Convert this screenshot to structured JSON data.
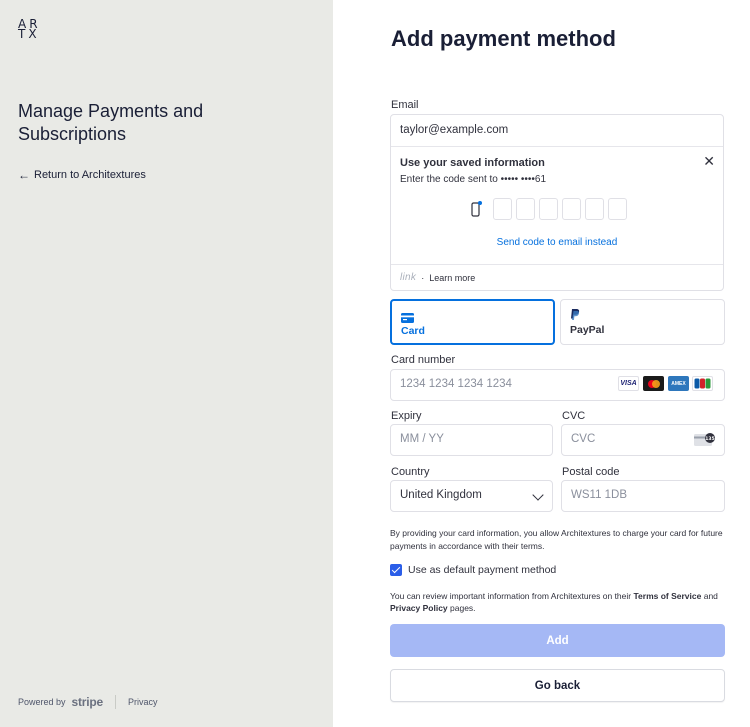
{
  "brand": {
    "logo_line1": "AR",
    "logo_line2": "TX"
  },
  "left": {
    "title": "Manage Payments and Subscriptions",
    "return_link": "Return to Architextures",
    "footer": {
      "powered_by": "Powered by",
      "stripe": "stripe",
      "privacy": "Privacy"
    }
  },
  "form": {
    "title": "Add payment method",
    "email": {
      "label": "Email",
      "value": "taylor@example.com"
    },
    "link": {
      "title": "Use your saved information",
      "subtitle": "Enter the code sent to ••••• ••••61",
      "send_email": "Send code to email instead",
      "brand": "link",
      "separator": "·",
      "learn_more": "Learn more",
      "close_icon": "close-icon"
    },
    "tabs": [
      {
        "label": "Card",
        "icon": "card-icon",
        "selected": true
      },
      {
        "label": "PayPal",
        "icon": "paypal-icon",
        "selected": false
      }
    ],
    "card_number": {
      "label": "Card number",
      "placeholder": "1234 1234 1234 1234"
    },
    "card_brands": [
      "VISA",
      "MC",
      "AMEX",
      "JCB"
    ],
    "expiry": {
      "label": "Expiry",
      "placeholder": "MM / YY"
    },
    "cvc": {
      "label": "CVC",
      "placeholder": "CVC",
      "icon_text": "135"
    },
    "country": {
      "label": "Country",
      "value": "United Kingdom"
    },
    "postal": {
      "label": "Postal code",
      "placeholder": "WS11 1DB"
    },
    "consent": "By providing your card information, you allow Architextures to charge your card for future payments in accordance with their terms.",
    "default_checkbox": {
      "label": "Use as default payment method",
      "checked": true
    },
    "review": {
      "prefix": "You can review important information from Architextures on their ",
      "terms": "Terms of Service",
      "and": " and ",
      "privacy": "Privacy Policy",
      "suffix": " pages."
    },
    "add_button": "Add",
    "back_button": "Go back"
  },
  "colors": {
    "accent": "#0570de",
    "add_disabled": "#a5b8f5",
    "left_bg": "#e9eae6",
    "checkbox": "#2b5ee8"
  }
}
